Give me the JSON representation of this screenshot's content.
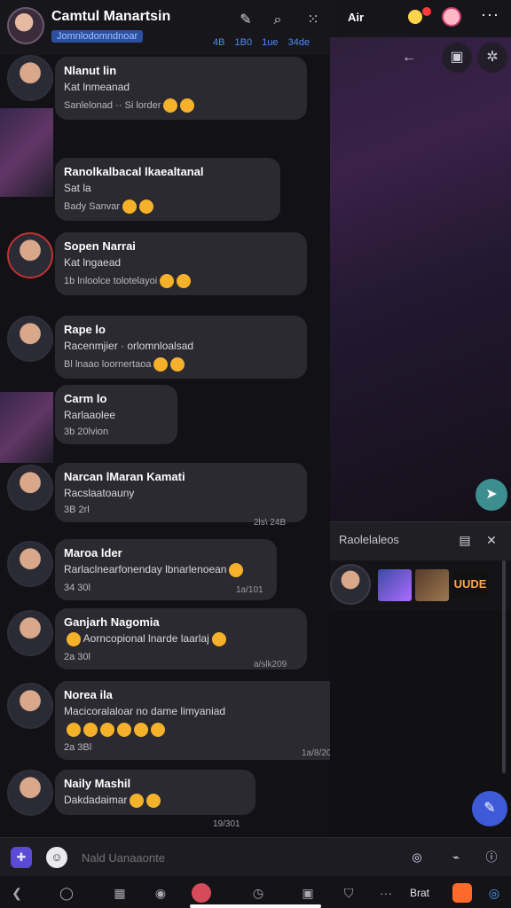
{
  "header": {
    "title": "Camtul Manartsin",
    "subtitle": "Jomnlodomndnoar",
    "stats": [
      "4B",
      "1B0",
      "1ue",
      "34de"
    ]
  },
  "topbar": {
    "label": "Air",
    "more": "···"
  },
  "media_controls": {
    "back_icon": "back-arrow-icon",
    "folder_icon": "folder-icon",
    "settings_icon": "settings-icon"
  },
  "chats": [
    {
      "name": "Nlanut lin",
      "line": "Kat lnmeanad",
      "sub": "Sanlelonad ·· Si lorder",
      "time": ""
    },
    {
      "name": "Ranolkalbacal lkaealtanal",
      "line": "Sat la",
      "sub": "Bady Sanvar",
      "time": ""
    },
    {
      "name": "Sopen Narrai",
      "line": "Kat lngaead",
      "sub": "1b lnloolce tolotelayoi",
      "time": ""
    },
    {
      "name": "Rape lo",
      "line": "Racenmjier · orlomnloalsad",
      "sub": "Bl lnaao loornertaoa",
      "time": ""
    },
    {
      "name": "Carm lo",
      "line": "Rarlaaolee",
      "sub": "3b  20lvion",
      "time": ""
    },
    {
      "name": "Narcan lMaran Kamati",
      "line": "Racslaatoauny",
      "sub": "3B  2rl",
      "time": "2ls\\ 24B"
    },
    {
      "name": "Maroa lder",
      "line": "Rarlaclnearfonenday lbnarlenoean",
      "sub": "34  30l",
      "time": "1a/101"
    },
    {
      "name": "Ganjarh Nagomia",
      "line": "Aorncopional lnarde laarlaj",
      "sub": "2a  30l",
      "time": "a/slk209"
    },
    {
      "name": "Norea ila",
      "line": "Macicoralaloar no dame limyaniad",
      "sub": "2a  3Bl",
      "time": "1a/8/20B"
    },
    {
      "name": "Naily Mashil",
      "line": "Dakdadaimar",
      "sub": "",
      "time": "19/301"
    }
  ],
  "mini_panel": {
    "label": "Raolelaleos"
  },
  "media_strip": {
    "label": "UUDE"
  },
  "composer": {
    "placeholder": "Nald Uanaaonte"
  },
  "bottom_nav": {
    "text": "Brat"
  }
}
